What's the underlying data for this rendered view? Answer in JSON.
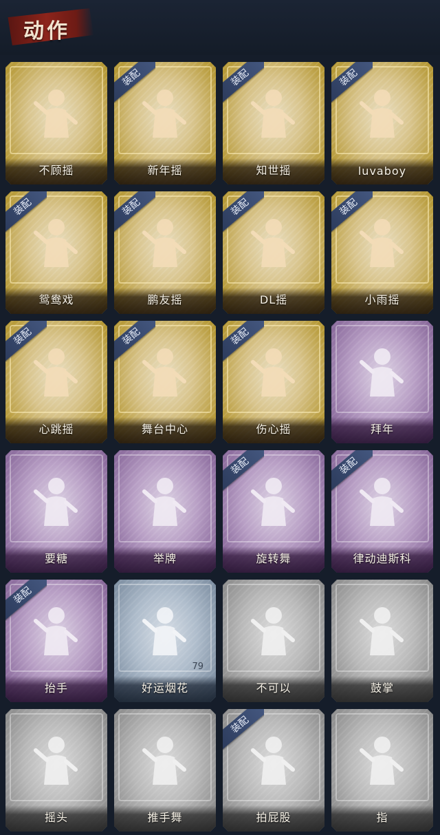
{
  "header": {
    "title": "动作"
  },
  "colors": {
    "gold": "#d8c48c",
    "purple": "#b89fc5",
    "blue": "#aebccb",
    "gray": "#b9b9b9",
    "equip_tag": "#3a4c72"
  },
  "equip_label": "装配",
  "cards": [
    {
      "label": "不顾摇",
      "rarity": "gold",
      "equipped": false,
      "icon": "dance-pointing-figure-icon"
    },
    {
      "label": "新年摇",
      "rarity": "gold",
      "equipped": true,
      "icon": "dance-figure-icon"
    },
    {
      "label": "知世摇",
      "rarity": "gold",
      "equipped": true,
      "icon": "dance-figure-icon"
    },
    {
      "label": "luvaboy",
      "rarity": "gold",
      "equipped": true,
      "icon": "dance-figure-icon"
    },
    {
      "label": "鸳鸯戏",
      "rarity": "gold",
      "equipped": true,
      "icon": "dance-figure-icon"
    },
    {
      "label": "鹏友摇",
      "rarity": "gold",
      "equipped": true,
      "icon": "dance-figure-icon"
    },
    {
      "label": "DL摇",
      "rarity": "gold",
      "equipped": true,
      "icon": "dance-arm-raised-figure-icon"
    },
    {
      "label": "小雨摇",
      "rarity": "gold",
      "equipped": true,
      "icon": "dance-figure-icon"
    },
    {
      "label": "心跳摇",
      "rarity": "gold",
      "equipped": true,
      "icon": "dance-hand-up-figure-icon"
    },
    {
      "label": "舞台中心",
      "rarity": "gold",
      "equipped": true,
      "icon": "dance-figure-icon"
    },
    {
      "label": "伤心摇",
      "rarity": "gold",
      "equipped": true,
      "icon": "heart-hands-figure-icon"
    },
    {
      "label": "拜年",
      "rarity": "purple",
      "equipped": false,
      "icon": "bow-figure-icon"
    },
    {
      "label": "要糖",
      "rarity": "purple",
      "equipped": false,
      "icon": "reach-figure-icon"
    },
    {
      "label": "举牌",
      "rarity": "purple",
      "equipped": false,
      "icon": "sign-holding-figure-icon"
    },
    {
      "label": "旋转舞",
      "rarity": "purple",
      "equipped": true,
      "icon": "spin-figure-icon"
    },
    {
      "label": "律动迪斯科",
      "rarity": "purple",
      "equipped": true,
      "icon": "disco-figure-icon"
    },
    {
      "label": "抬手",
      "rarity": "purple",
      "equipped": true,
      "icon": "raise-hand-figure-icon"
    },
    {
      "label": "好运烟花",
      "rarity": "blue",
      "equipped": false,
      "icon": "firework-icon",
      "count": "79"
    },
    {
      "label": "不可以",
      "rarity": "gray",
      "equipped": false,
      "icon": "finger-wag-icon"
    },
    {
      "label": "鼓掌",
      "rarity": "gray",
      "equipped": false,
      "icon": "clapping-hands-icon"
    },
    {
      "label": "摇头",
      "rarity": "gray",
      "equipped": false,
      "icon": "head-shake-figure-icon"
    },
    {
      "label": "推手舞",
      "rarity": "gray",
      "equipped": false,
      "icon": "push-dance-figure-icon"
    },
    {
      "label": "拍屁股",
      "rarity": "gray",
      "equipped": true,
      "icon": "butt-slap-figure-icon"
    },
    {
      "label": "指",
      "rarity": "gray",
      "equipped": false,
      "icon": "pointing-hand-icon"
    }
  ]
}
